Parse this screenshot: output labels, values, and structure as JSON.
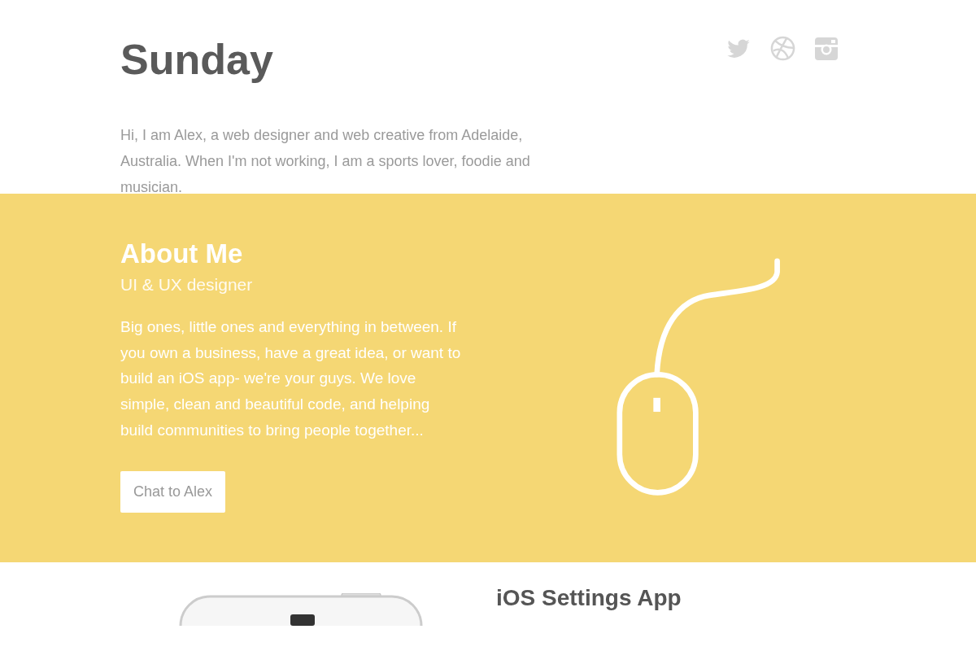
{
  "header": {
    "title": "Sunday",
    "intro": "Hi, I am Alex, a web designer and web creative from Adelaide, Australia. When I'm not working, I am a sports lover, foodie and musician.",
    "social": [
      {
        "kind": "twitter"
      },
      {
        "kind": "dribbble"
      },
      {
        "kind": "instagram"
      }
    ]
  },
  "about": {
    "title": "About Me",
    "subtitle": "UI & UX designer",
    "body": "Big ones, little ones and everything in between. If you own a business, have a great idea, or want to build an iOS app- we're your guys. We love simple, clean and beautiful code, and helping build communities to bring people together...",
    "button": "Chat to Alex"
  },
  "project": {
    "title": "iOS Settings App"
  }
}
